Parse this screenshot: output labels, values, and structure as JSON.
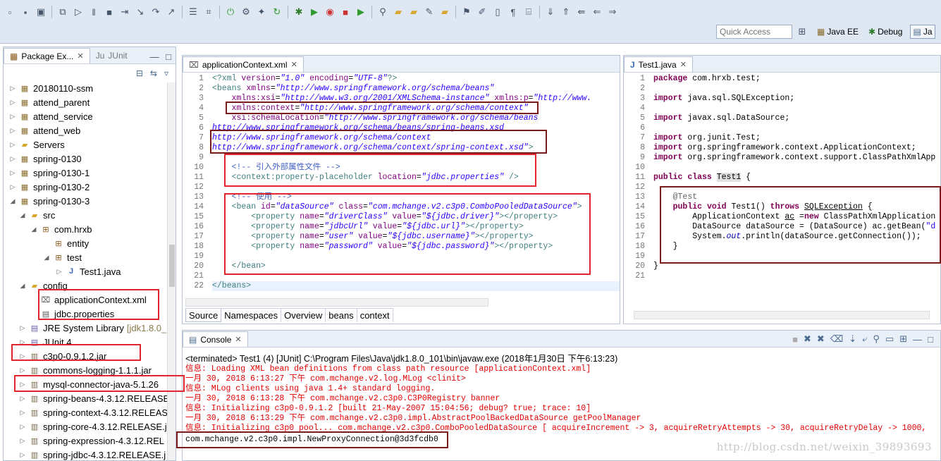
{
  "toolbar": {
    "quick_access_placeholder": "Quick Access",
    "perspectives": [
      "Java EE",
      "Debug",
      "Ja"
    ]
  },
  "package_explorer": {
    "tab_label": "Package Ex...",
    "junit_tab_label": "JUnit",
    "items": [
      {
        "label": "20180110-ssm",
        "kind": "project"
      },
      {
        "label": "attend_parent",
        "kind": "project"
      },
      {
        "label": "attend_service",
        "kind": "project"
      },
      {
        "label": "attend_web",
        "kind": "project"
      },
      {
        "label": "Servers",
        "kind": "folder"
      },
      {
        "label": "spring-0130",
        "kind": "project"
      },
      {
        "label": "spring-0130-1",
        "kind": "project"
      },
      {
        "label": "spring-0130-2",
        "kind": "project"
      },
      {
        "label": "spring-0130-3",
        "kind": "project"
      },
      {
        "label": "src",
        "kind": "folder"
      },
      {
        "label": "com.hrxb",
        "kind": "package"
      },
      {
        "label": "entity",
        "kind": "package"
      },
      {
        "label": "test",
        "kind": "package"
      },
      {
        "label": "Test1.java",
        "kind": "java"
      },
      {
        "label": "config",
        "kind": "folder"
      },
      {
        "label": "applicationContext.xml",
        "kind": "xml"
      },
      {
        "label": "jdbc.properties",
        "kind": "props"
      },
      {
        "label": "JRE System Library",
        "kind": "lib",
        "suffix": "[jdk1.8.0_"
      },
      {
        "label": "JUnit 4",
        "kind": "lib"
      },
      {
        "label": "c3p0-0.9.1.2.jar",
        "kind": "jar"
      },
      {
        "label": "commons-logging-1.1.1.jar",
        "kind": "jar"
      },
      {
        "label": "mysql-connector-java-5.1.26",
        "kind": "jar"
      },
      {
        "label": "spring-beans-4.3.12.RELEASE",
        "kind": "jar"
      },
      {
        "label": "spring-context-4.3.12.RELEAS",
        "kind": "jar"
      },
      {
        "label": "spring-core-4.3.12.RELEASE.j",
        "kind": "jar"
      },
      {
        "label": "spring-expression-4.3.12.REL",
        "kind": "jar"
      },
      {
        "label": "spring-jdbc-4.3.12.RELEASE.j",
        "kind": "jar"
      }
    ]
  },
  "xml_editor": {
    "tab_label": "applicationContext.xml",
    "bottom_tabs": [
      "Source",
      "Namespaces",
      "Overview",
      "beans",
      "context"
    ],
    "line_numbers": [
      "1",
      "2",
      "3",
      "4",
      "5",
      "6",
      "7",
      "8",
      "9",
      "10",
      "11",
      "12",
      "13",
      "14",
      "15",
      "16",
      "17",
      "18",
      "19",
      "20",
      "21",
      "22"
    ]
  },
  "java_editor": {
    "tab_label": "Test1.java",
    "line_numbers": [
      "1",
      "2",
      "3",
      "4",
      "5",
      "6",
      "7",
      "8",
      "9",
      "10",
      "11",
      "12",
      "13",
      "14",
      "15",
      "16",
      "17",
      "18",
      "19",
      "20",
      "21"
    ]
  },
  "console": {
    "tab_label": "Console",
    "terminated": "<terminated> Test1 (4) [JUnit] C:\\Program Files\\Java\\jdk1.8.0_101\\bin\\javaw.exe (2018年1月30日 下午6:13:23)",
    "lines": [
      {
        "text": "信息: Loading XML bean definitions from class path resource [applicationContext.xml]",
        "color": "red"
      },
      {
        "text": "一月 30, 2018 6:13:27 下午 com.mchange.v2.log.MLog <clinit>",
        "color": "red"
      },
      {
        "text": "信息: MLog clients using java 1.4+ standard logging.",
        "color": "red"
      },
      {
        "text": "一月 30, 2018 6:13:28 下午 com.mchange.v2.c3p0.C3P0Registry banner",
        "color": "red"
      },
      {
        "text": "信息: Initializing c3p0-0.9.1.2 [built 21-May-2007 15:04:56; debug? true; trace: 10]",
        "color": "red"
      },
      {
        "text": "一月 30, 2018 6:13:29 下午 com.mchange.v2.c3p0.impl.AbstractPoolBackedDataSource getPoolManager",
        "color": "red"
      },
      {
        "text": "信息: Initializing c3p0 pool... com.mchange.v2.c3p0.ComboPooledDataSource [ acquireIncrement -> 3, acquireRetryAttempts -> 30, acquireRetryDelay -> 1000,",
        "color": "red"
      },
      {
        "text": "com.mchange.v2.c3p0.impl.NewProxyConnection@3d3fcdb0",
        "color": "black"
      }
    ],
    "watermark": "http://blog.csdn.net/weixin_39893693"
  },
  "colors": {
    "annotation_red": "#e0262e",
    "annotation_dark": "#7a1a1a"
  }
}
